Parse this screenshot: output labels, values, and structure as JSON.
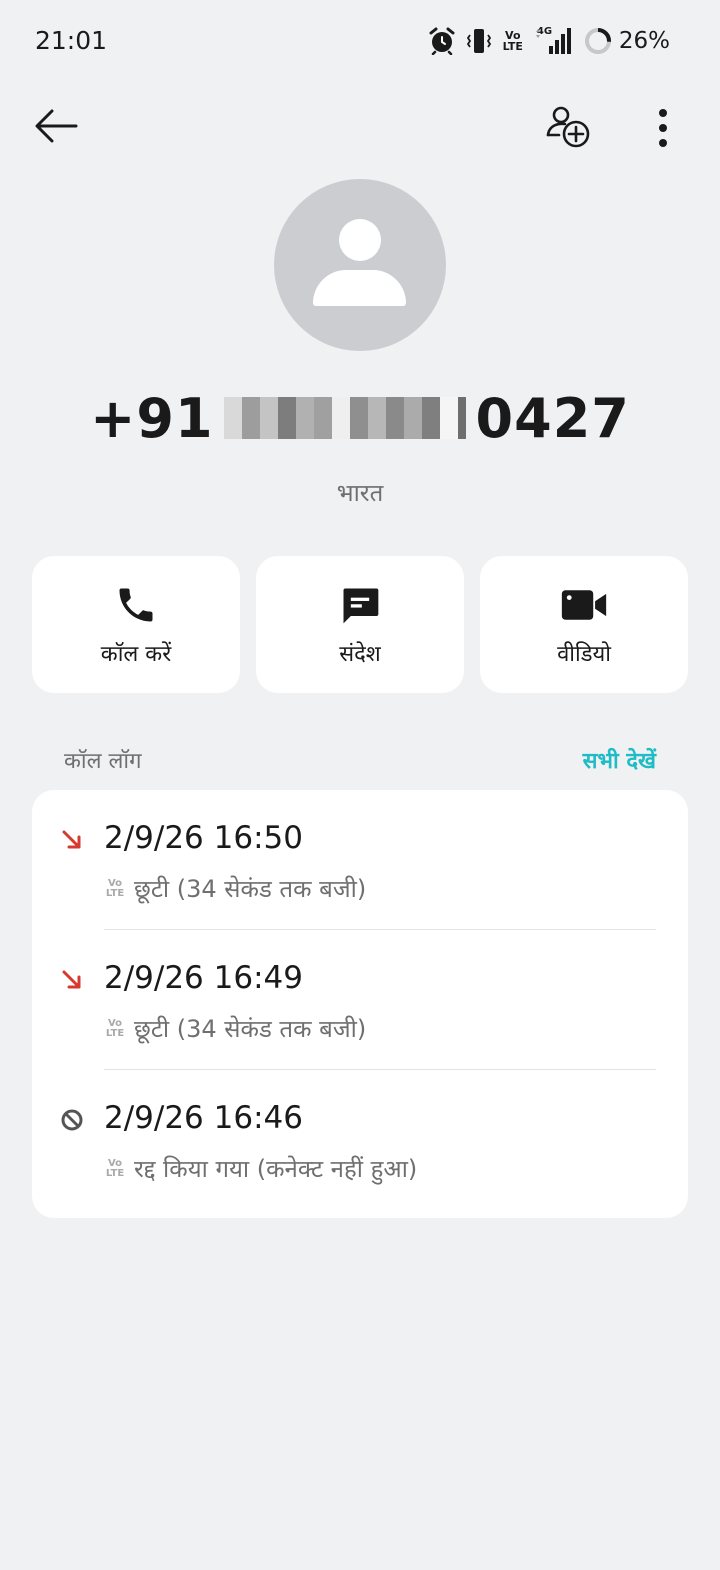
{
  "status_bar": {
    "time": "21:01",
    "icons": [
      "alarm-icon",
      "vibrate-icon",
      "volte-icon",
      "signal-4g-icon",
      "battery-ring-icon"
    ],
    "volte_top": "Vo",
    "volte_bottom": "LTE",
    "network": "4G",
    "battery_percent": "26%",
    "battery_level": 0.26
  },
  "top_bar": {
    "icons": [
      "back-arrow-icon",
      "add-contact-icon",
      "more-vert-icon"
    ]
  },
  "contact": {
    "number_prefix": "+91",
    "number_suffix": "0427",
    "country": "भारत"
  },
  "actions": [
    {
      "label": "कॉल करें",
      "icon": "phone-icon"
    },
    {
      "label": "संदेश",
      "icon": "message-icon"
    },
    {
      "label": "वीडियो",
      "icon": "video-icon"
    }
  ],
  "call_log": {
    "title": "कॉल लॉग",
    "see_all": "सभी देखें",
    "entries": [
      {
        "time": "2/9/26 16:50",
        "type": "missed",
        "icon": "missed-call-icon",
        "network_top": "Vo",
        "network_bottom": "LTE",
        "desc": "छूटी (34 सेकंड तक बजी)"
      },
      {
        "time": "2/9/26 16:49",
        "type": "missed",
        "icon": "missed-call-icon",
        "network_top": "Vo",
        "network_bottom": "LTE",
        "desc": "छूटी (34 सेकंड तक बजी)"
      },
      {
        "time": "2/9/26 16:46",
        "type": "rejected",
        "icon": "blocked-call-icon",
        "network_top": "Vo",
        "network_bottom": "LTE",
        "desc": "रद्द किया गया (कनेक्ट नहीं हुआ)"
      }
    ]
  },
  "colors": {
    "background": "#f0f1f3",
    "card": "#ffffff",
    "accent": "#1fbcc5",
    "missed": "#d63a2f",
    "secondary_text": "#6f6f6f",
    "avatar": "#cbcdd0"
  }
}
